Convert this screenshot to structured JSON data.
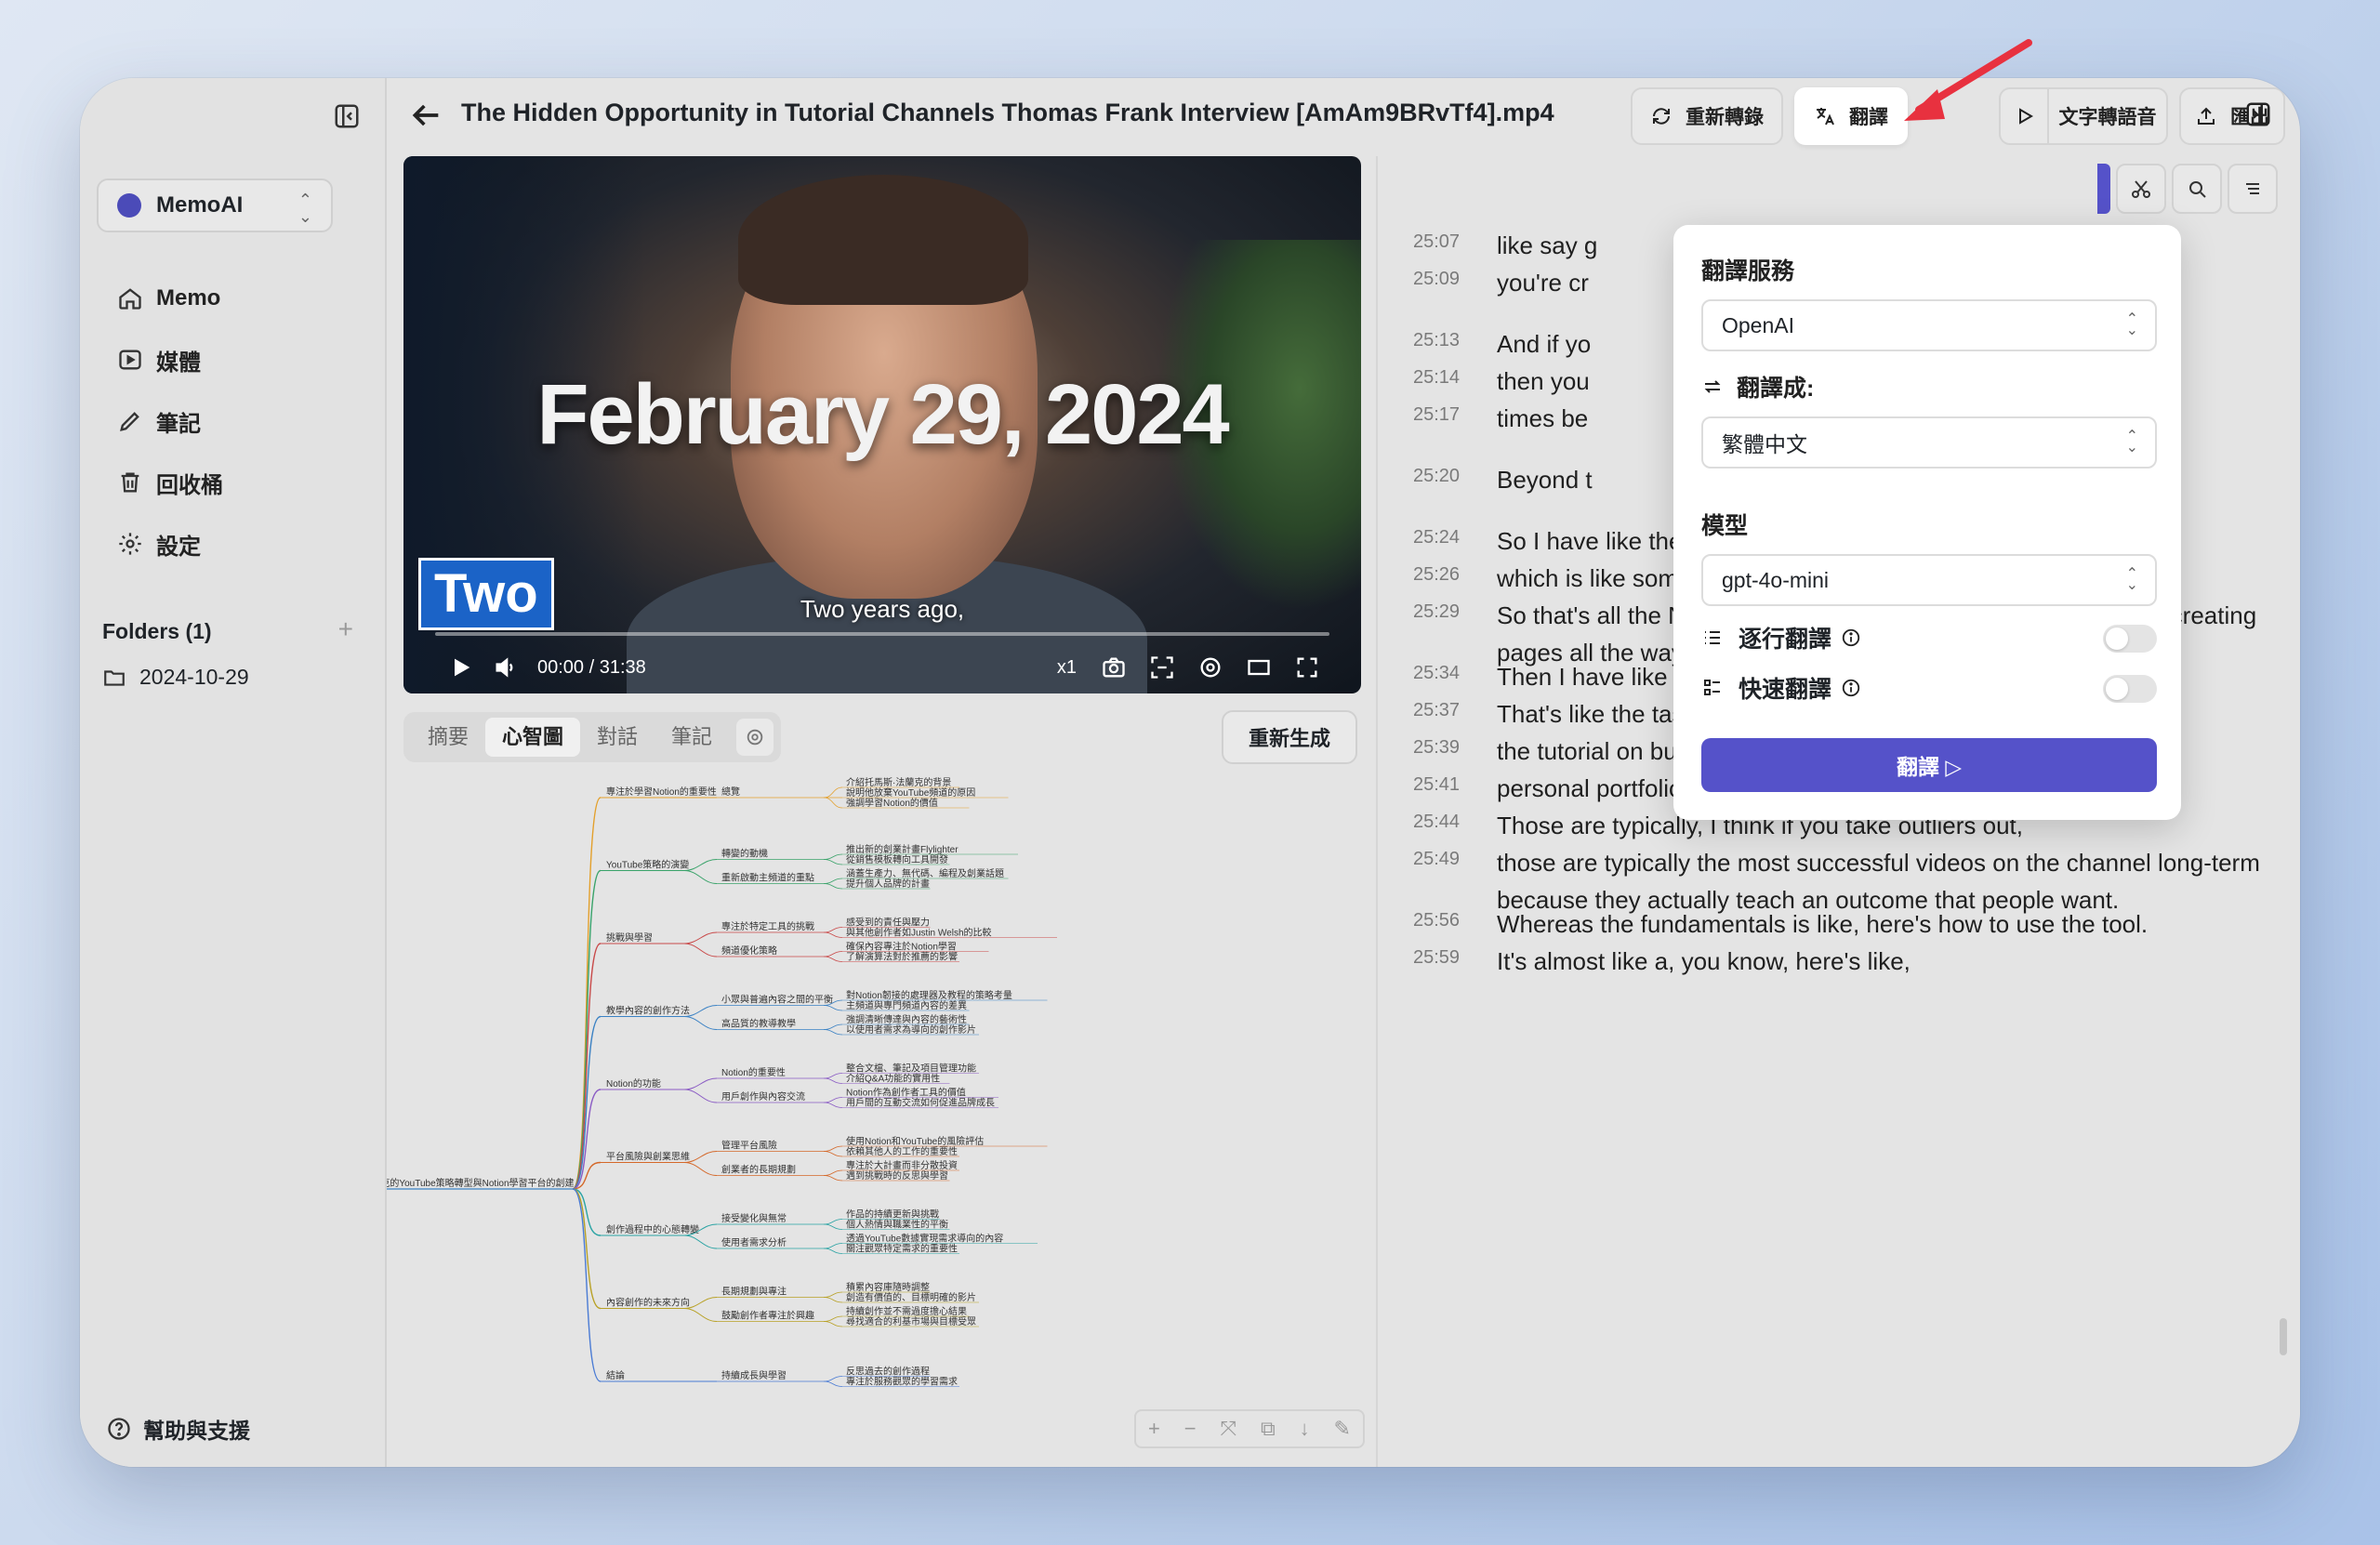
{
  "app": {
    "workspace": "MemoAI"
  },
  "sidebar": {
    "items": [
      {
        "label": "Memo",
        "icon": "home-icon"
      },
      {
        "label": "媒體",
        "icon": "media-icon"
      },
      {
        "label": "筆記",
        "icon": "pencil-icon"
      },
      {
        "label": "回收桶",
        "icon": "trash-icon"
      },
      {
        "label": "設定",
        "icon": "gear-icon"
      }
    ],
    "folders_label": "Folders (1)",
    "folder_add": "+",
    "folders": [
      "2024-10-29"
    ],
    "help_label": "幫助與支援"
  },
  "header": {
    "title": "The Hidden Opportunity in Tutorial Channels Thomas Frank Interview [AmAm9BRvTf4].mp4",
    "buttons": {
      "retranscribe": "重新轉錄",
      "translate": "翻譯",
      "tts": "文字轉語音",
      "export": "匯出"
    }
  },
  "video": {
    "overlay_date": "February 29, 2024",
    "overlay_badge": "Two",
    "subtitle": "Two years ago,",
    "time": "00:00 / 31:38",
    "speed": "x1",
    "progress": 0
  },
  "tabs": {
    "items": [
      "摘要",
      "心智圖",
      "對話",
      "筆記"
    ],
    "active": "心智圖",
    "regenerate": "重新生成"
  },
  "mindmap": {
    "root": "托馬斯·法蘭克的YouTube策略轉型與Notion學習平台的創建",
    "branches": [
      {
        "label": "專注於學習Notion的重要性",
        "subs": [
          {
            "label": "總覽",
            "leaves": [
              "介紹托馬斯·法蘭克的背景",
              "說明他放棄YouTube頻道的原因",
              "強調學習Notion的價值"
            ]
          }
        ]
      },
      {
        "label": "YouTube策略的演變",
        "subs": [
          {
            "label": "轉變的動機",
            "leaves": [
              "推出新的創業計畫Flylighter",
              "從銷售模板轉向工具開發"
            ]
          },
          {
            "label": "重新啟動主頻道的重點",
            "leaves": [
              "涵蓋生產力、無代碼、編程及創業話題",
              "提升個人品牌的計畫"
            ]
          }
        ]
      },
      {
        "label": "挑戰與學習",
        "subs": [
          {
            "label": "專注於特定工具的挑戰",
            "leaves": [
              "感受到的責任與壓力",
              "與其他創作者如Justin Welsh的比較"
            ]
          },
          {
            "label": "頻道優化策略",
            "leaves": [
              "確保內容專注於Notion學習",
              "了解演算法對於推薦的影響"
            ]
          }
        ]
      },
      {
        "label": "教學內容的創作方法",
        "subs": [
          {
            "label": "小眾與普遍內容之間的平衡",
            "leaves": [
              "對Notion韌接的處理器及教程的策略考量",
              "主頻道與專門頻道內容的差異"
            ]
          },
          {
            "label": "高品質的教導教學",
            "leaves": [
              "強調清晰傳達與內容的藝術性",
              "以使用者需求為導向的創作影片"
            ]
          }
        ]
      },
      {
        "label": "Notion的功能",
        "subs": [
          {
            "label": "Notion的重要性",
            "leaves": [
              "整合文檔、筆記及項目管理功能",
              "介紹Q&A功能的實用性"
            ]
          },
          {
            "label": "用戶創作與內容交流",
            "leaves": [
              "Notion作為創作者工具的價值",
              "用戶間的互動交流如何促進品牌成長"
            ]
          }
        ]
      },
      {
        "label": "平台風險與創業思維",
        "subs": [
          {
            "label": "管理平台風險",
            "leaves": [
              "使用Notion和YouTube的風險評估",
              "依賴其他人的工作的重要性"
            ]
          },
          {
            "label": "創業者的長期規劃",
            "leaves": [
              "專注於大計畫而非分散投資",
              "遇到挑戰時的反思與學習"
            ]
          }
        ]
      },
      {
        "label": "創作過程中的心態轉變",
        "subs": [
          {
            "label": "接受變化與無常",
            "leaves": [
              "作品的持續更新與挑戰",
              "個人熱情與職業性的平衡"
            ]
          },
          {
            "label": "使用者需求分析",
            "leaves": [
              "透過YouTube數據實現需求導向的內容",
              "關注觀眾特定需求的重要性"
            ]
          }
        ]
      },
      {
        "label": "內容創作的未來方向",
        "subs": [
          {
            "label": "長期規劃與專注",
            "leaves": [
              "積累內容庫隨時調整",
              "創造有價值的、目標明確的影片"
            ]
          },
          {
            "label": "鼓勵創作者專注於興趣",
            "leaves": [
              "持續創作並不需過度擔心結果",
              "尋找適合的利基市場與目標受眾"
            ]
          }
        ]
      },
      {
        "label": "結論",
        "subs": [
          {
            "label": "持續成長與學習",
            "leaves": [
              "反思過去的創作過程",
              "專注於服務觀眾的學習需求"
            ]
          }
        ]
      }
    ]
  },
  "translate_popover": {
    "service_label": "翻譯服務",
    "service_value": "OpenAI",
    "target_label": "翻譯成:",
    "target_value": "繁體中文",
    "model_label": "模型",
    "model_value": "gpt-4o-mini",
    "line_by_line_label": "逐行翻譯",
    "line_by_line_on": false,
    "fast_label": "快速翻譯",
    "fast_on": false,
    "submit": "翻譯 ▷"
  },
  "transcript": [
    {
      "time": "25:07",
      "text": "like say g"
    },
    {
      "time": "25:09",
      "text": "you're cr                                                    remake videos."
    },
    {
      "time": "25:13",
      "text": "And if yo"
    },
    {
      "time": "25:14",
      "text": "then you                                                     10,000"
    },
    {
      "time": "25:17",
      "text": "times be                                                     n the first rep in."
    },
    {
      "time": "25:20",
      "text": "Beyond t                                                     has Frank explains."
    },
    {
      "time": "25:24",
      "text": "So I have like the fundamentals pillar,"
    },
    {
      "time": "25:26",
      "text": "which is like somebody wants to learn how to use Notion."
    },
    {
      "time": "25:29",
      "text": "So that's all the Notion fundamentals videos from the basics of creating pages all the way up through databases."
    },
    {
      "time": "25:34",
      "text": "Then I have like the build guides and tutorials pillar."
    },
    {
      "time": "25:37",
      "text": "That's like the task manager tutorial,"
    },
    {
      "time": "25:39",
      "text": "the tutorial on building a habit tracker,"
    },
    {
      "time": "25:41",
      "text": "personal portfolio website on Notion."
    },
    {
      "time": "25:44",
      "text": "Those are typically, I think if you take outliers out,"
    },
    {
      "time": "25:49",
      "text": "those are typically the most successful videos on the channel long-term because they actually teach an outcome that people want."
    },
    {
      "time": "25:56",
      "text": "Whereas the fundamentals is like, here's how to use the tool."
    },
    {
      "time": "25:59",
      "text": "It's almost like a, you know, here's like,"
    }
  ],
  "colors": {
    "accent": "#5552c9",
    "annotation_arrow": "#e8313f"
  }
}
